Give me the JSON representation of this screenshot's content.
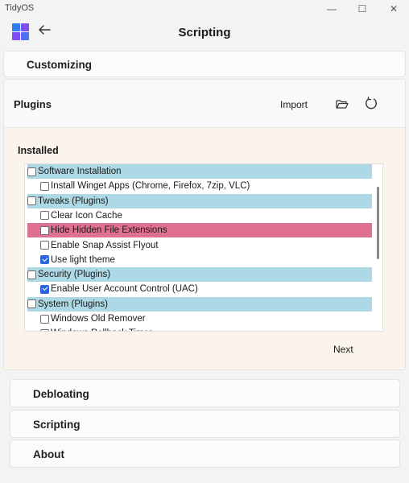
{
  "window": {
    "title": "TidyOS",
    "minimize_glyph": "—",
    "maximize_glyph": "☐",
    "close_glyph": "✕"
  },
  "header": {
    "title": "Scripting",
    "logo_colors": [
      "#2f7ef0",
      "#7f4ef0",
      "#7f4ef0",
      "#4f6ff0"
    ]
  },
  "sections": {
    "customizing": "Customizing",
    "debloating": "Debloating",
    "scripting": "Scripting",
    "about": "About"
  },
  "plugins": {
    "title": "Plugins",
    "import_label": "Import",
    "folder_icon": "folder-open-icon",
    "refresh_icon": "refresh-icon",
    "installed_label": "Installed",
    "next_label": "Next",
    "colors": {
      "category": "#add8e6",
      "highlight": "#e07092",
      "check": "#2b66d9"
    },
    "items": [
      {
        "label": "Software Installation",
        "category": true,
        "checked": false
      },
      {
        "label": "Install Winget Apps (Chrome, Firefox, 7zip, VLC)",
        "category": false,
        "checked": false
      },
      {
        "label": "Tweaks (Plugins)",
        "category": true,
        "checked": false
      },
      {
        "label": "Clear Icon Cache",
        "category": false,
        "checked": false
      },
      {
        "label": "Hide Hidden File Extensions",
        "category": false,
        "checked": false,
        "highlighted": true
      },
      {
        "label": "Enable Snap Assist Flyout",
        "category": false,
        "checked": false
      },
      {
        "label": "Use light theme",
        "category": false,
        "checked": true
      },
      {
        "label": "Security (Plugins)",
        "category": true,
        "checked": false
      },
      {
        "label": "Enable User Account Control (UAC)",
        "category": false,
        "checked": true
      },
      {
        "label": "System (Plugins)",
        "category": true,
        "checked": false
      },
      {
        "label": "Windows Old Remover",
        "category": false,
        "checked": false
      },
      {
        "label": "Windows Rollback Timer",
        "category": false,
        "checked": false
      }
    ]
  }
}
